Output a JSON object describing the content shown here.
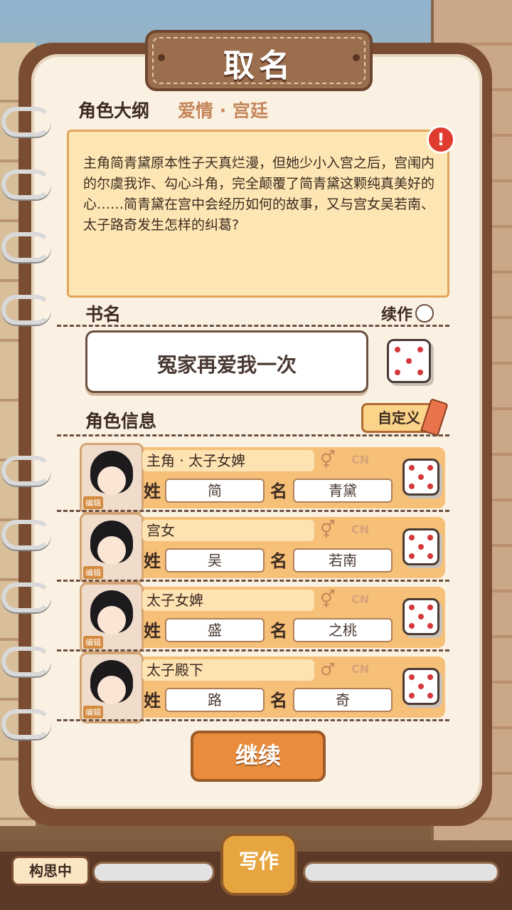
{
  "title": "取名",
  "outline": {
    "label": "角色大纲",
    "genre": "爱情 · 宫廷",
    "text": "主角简青黛原本性子天真烂漫，但她少小入宫之后，宫闱内的尔虞我诈、勾心斗角，完全颠覆了简青黛这颗纯真美好的心……简青黛在宫中会经历如何的故事，又与宫女吴若南、太子路奇发生怎样的纠葛?"
  },
  "book": {
    "label": "书名",
    "sequel_label": "续作",
    "title_value": "冤家再爱我一次"
  },
  "characters_section": {
    "label": "角色信息",
    "custom_label": "自定义"
  },
  "labels": {
    "surname": "姓",
    "given": "名",
    "cn": "CN",
    "edit": "编辑"
  },
  "characters": [
    {
      "role": "主角 · 太子女婢",
      "gender_icon": "⚥",
      "surname": "简",
      "given": "青黛"
    },
    {
      "role": "宫女",
      "gender_icon": "⚥",
      "surname": "吴",
      "given": "若南"
    },
    {
      "role": "太子女婢",
      "gender_icon": "⚥",
      "surname": "盛",
      "given": "之桃"
    },
    {
      "role": "太子殿下",
      "gender_icon": "♂",
      "surname": "路",
      "given": "奇"
    }
  ],
  "continue_label": "继续",
  "bottom": {
    "status": "构思中",
    "write_label": "写作"
  }
}
